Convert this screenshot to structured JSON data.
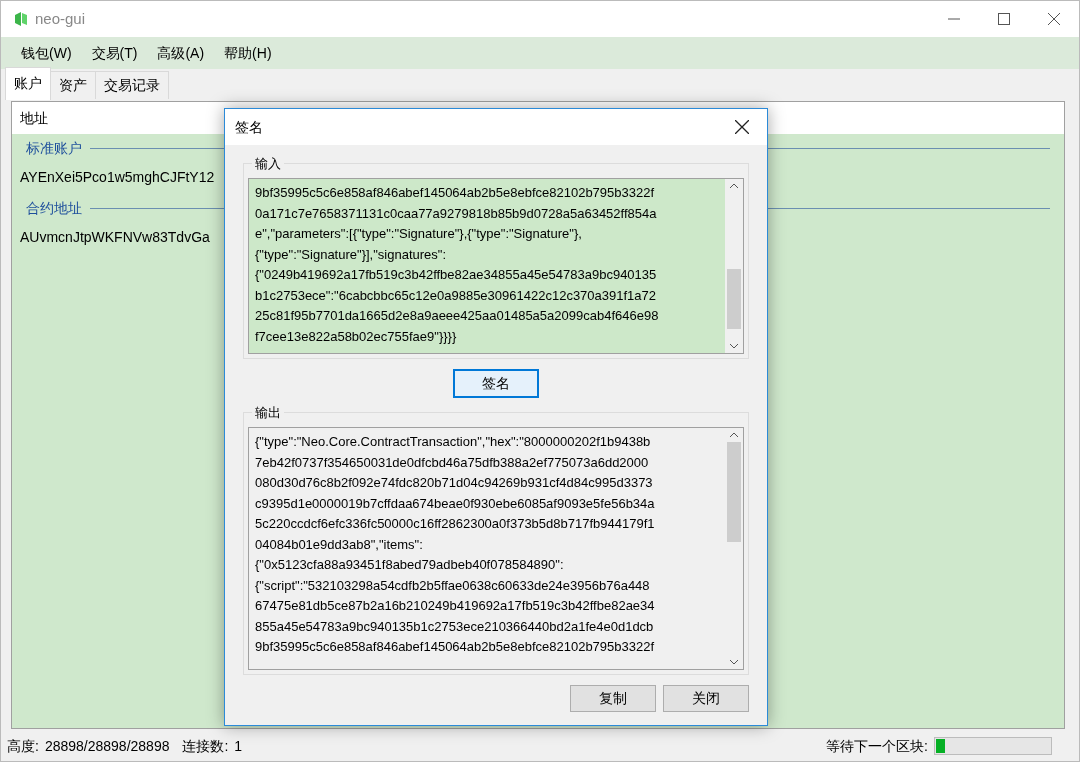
{
  "window": {
    "title": "neo-gui"
  },
  "menu": [
    "钱包(W)",
    "交易(T)",
    "高级(A)",
    "帮助(H)"
  ],
  "tabs": [
    {
      "label": "账户",
      "selected": true
    },
    {
      "label": "资产",
      "selected": false
    },
    {
      "label": "交易记录",
      "selected": false
    }
  ],
  "list": {
    "columns": [
      "地址"
    ],
    "groups": [
      {
        "label": "标准账户",
        "rows": [
          "AYEnXei5Pco1w5mghCJFtY12"
        ]
      },
      {
        "label": "合约地址",
        "rows": [
          "AUvmcnJtpWKFNVw83TdvGa"
        ]
      }
    ]
  },
  "dialog": {
    "title": "签名",
    "input": {
      "label": "输入",
      "lines": [
        "9bf35995c5c6e858af846abef145064ab2b5e8ebfce82102b795b3322f",
        "0a171c7e7658371131c0caa77a9279818b85b9d0728a5a63452ff854a",
        "e\",\"parameters\":[{\"type\":\"Signature\"},{\"type\":\"Signature\"},",
        "{\"type\":\"Signature\"}],\"signatures\":",
        "{\"0249b419692a17fb519c3b42ffbe82ae34855a45e54783a9bc940135",
        "b1c2753ece\":\"6cabcbbc65c12e0a9885e30961422c12c370a391f1a72",
        "25c81f95b7701da1665d2e8a9aeee425aa01485a5a2099cab4f646e98",
        "f7cee13e822a58b02ec755fae9\"}}}}"
      ]
    },
    "sign_button": "签名",
    "output": {
      "label": "输出",
      "lines": [
        "{\"type\":\"Neo.Core.ContractTransaction\",\"hex\":\"8000000202f1b9438b",
        "7eb42f0737f354650031de0dfcbd46a75dfb388a2ef775073a6dd2000",
        "080d30d76c8b2f092e74fdc820b71d04c94269b931cf4d84c995d3373",
        "c9395d1e0000019b7cffdaa674beae0f930ebe6085af9093e5fe56b34a",
        "5c220ccdcf6efc336fc50000c16ff2862300a0f373b5d8b717fb944179f1",
        "04084b01e9dd3ab8\",\"items\":",
        "{\"0x5123cfa88a93451f8abed79adbeb40f078584890\":",
        "{\"script\":\"532103298a54cdfb2b5ffae0638c60633de24e3956b76a448",
        "67475e81db5ce87b2a16b210249b419692a17fb519c3b42ffbe82ae34",
        "855a45e54783a9bc940135b1c2753ece210366440bd2a1fe4e0d1dcb",
        "9bf35995c5c6e858af846abef145064ab2b5e8ebfce82102b795b3322f"
      ]
    },
    "buttons": [
      "复制",
      "关闭"
    ]
  },
  "status_bar": {
    "height_label": "高度:",
    "height": "28898/28898/28898",
    "connections_label": "连接数:",
    "connections": "1",
    "waiting_label": "等待下一个区块:",
    "progress": {
      "level": 0.08
    }
  }
}
